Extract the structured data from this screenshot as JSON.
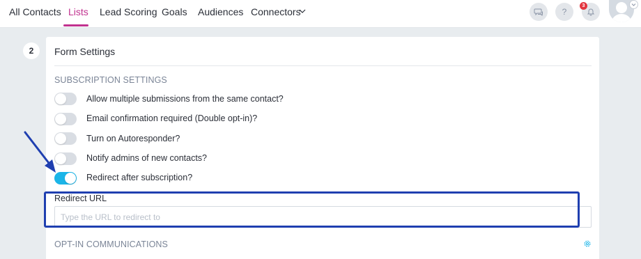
{
  "nav": {
    "tabs": [
      {
        "label": "All Contacts"
      },
      {
        "label": "Lists"
      },
      {
        "label": "Lead Scoring"
      },
      {
        "label": "Goals"
      },
      {
        "label": "Audiences"
      },
      {
        "label": "Connectors"
      }
    ],
    "active_tab": "Lists",
    "help_label": "?",
    "notification_count": "3"
  },
  "step_number": "2",
  "form_settings": {
    "title": "Form Settings",
    "subscription_heading": "SUBSCRIPTION SETTINGS",
    "options": [
      {
        "label": "Allow multiple submissions from the same contact?",
        "enabled": false
      },
      {
        "label": "Email confirmation required (Double opt-in)?",
        "enabled": false
      },
      {
        "label": "Turn on Autoresponder?",
        "enabled": false
      },
      {
        "label": "Notify admins of new contacts?",
        "enabled": false
      },
      {
        "label": "Redirect after subscription?",
        "enabled": true
      }
    ],
    "redirect_url": {
      "label": "Redirect URL",
      "value": "",
      "placeholder": "Type the URL to redirect to"
    },
    "optin_heading": "OPT-IN COMMUNICATIONS"
  },
  "colors": {
    "accent": "#c1328f",
    "toggle_on": "#1bb5e8",
    "annotation": "#1f3fb0"
  }
}
